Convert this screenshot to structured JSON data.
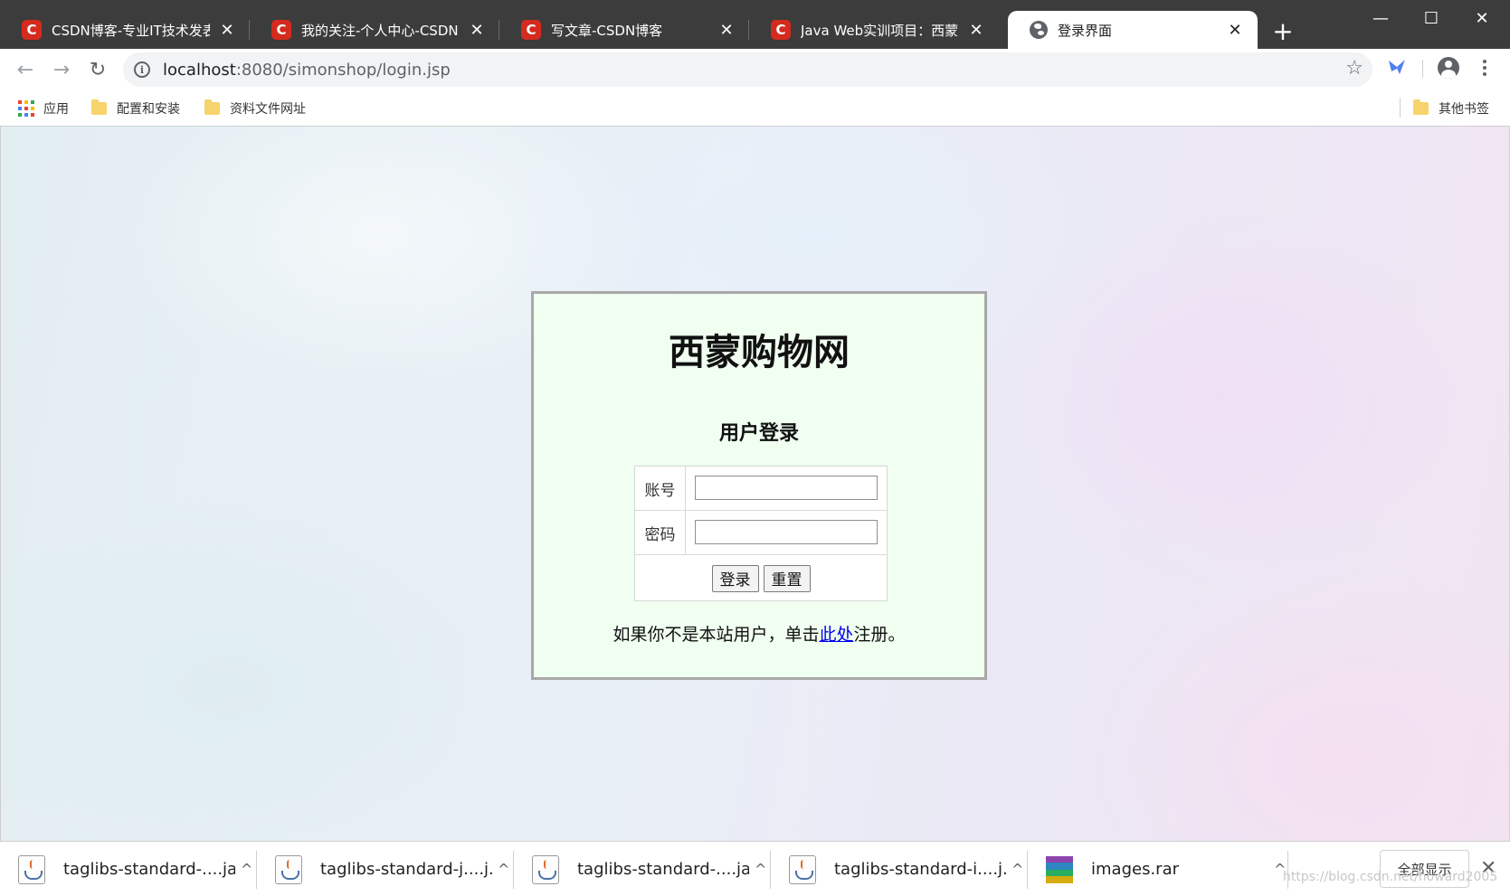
{
  "browser": {
    "tabs": [
      {
        "title": "CSDN博客-专业IT技术发表平",
        "icon": "csdn-icon",
        "active": false
      },
      {
        "title": "我的关注-个人中心-CSDN",
        "icon": "csdn-icon",
        "active": false
      },
      {
        "title": "写文章-CSDN博客",
        "icon": "csdn-icon",
        "active": false
      },
      {
        "title": "Java Web实训项目：西蒙购",
        "icon": "csdn-icon",
        "active": false
      },
      {
        "title": "登录界面",
        "icon": "globe-icon",
        "active": true
      }
    ],
    "favicon_letter": "C",
    "close_glyph": "✕",
    "new_tab_glyph": "+",
    "window_controls": {
      "minimize": "—",
      "maximize": "☐",
      "close": "✕"
    },
    "nav": {
      "back": "←",
      "forward": "→",
      "reload": "↻"
    },
    "address": {
      "host": "localhost",
      "rest": ":8080/simonshop/login.jsp",
      "info_glyph": "i",
      "star_glyph": "☆"
    },
    "bookmarks": [
      {
        "label": "应用",
        "icon": "apps-icon"
      },
      {
        "label": "配置和安装",
        "icon": "folder-icon"
      },
      {
        "label": "资料文件网址",
        "icon": "folder-icon"
      }
    ],
    "other_bookmarks": "其他书签"
  },
  "page": {
    "site_title": "西蒙购物网",
    "subtitle": "用户登录",
    "form": {
      "username_label": "账号",
      "username_value": "",
      "password_label": "密码",
      "password_value": "",
      "login_button": "登录",
      "reset_button": "重置"
    },
    "register": {
      "prefix": "如果你不是本站用户，单击",
      "link": "此处",
      "suffix": "注册。"
    }
  },
  "downloads": {
    "items": [
      {
        "name": "taglibs-standard-....jar",
        "icon": "java-file-icon"
      },
      {
        "name": "taglibs-standard-j....j...",
        "icon": "java-file-icon"
      },
      {
        "name": "taglibs-standard-....jar",
        "icon": "java-file-icon"
      },
      {
        "name": "taglibs-standard-i....j...",
        "icon": "java-file-icon"
      },
      {
        "name": "images.rar",
        "icon": "rar-archive-icon"
      }
    ],
    "caret_glyph": "^",
    "show_all": "全部显示",
    "close_glyph": "✕"
  },
  "watermark": "https://blog.csdn.net/howard2005",
  "colors": {
    "tabstrip": "#3c3c3c",
    "csdn_red": "#d52b1e",
    "login_box_bg": "#f0fff0",
    "link": "#0000ee"
  }
}
